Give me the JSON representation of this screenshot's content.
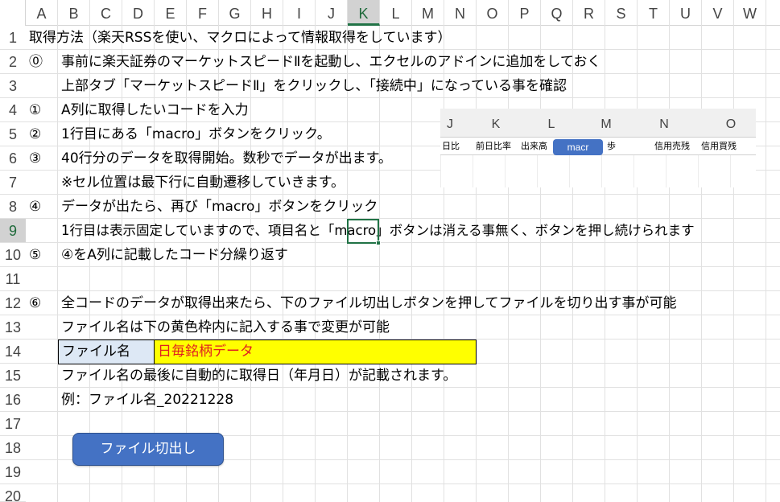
{
  "columns": [
    "A",
    "B",
    "C",
    "D",
    "E",
    "F",
    "G",
    "H",
    "I",
    "J",
    "K",
    "L",
    "M",
    "N",
    "O",
    "P",
    "Q",
    "R",
    "S",
    "T",
    "U",
    "V",
    "W"
  ],
  "active_column": "K",
  "rows": [
    "1",
    "2",
    "3",
    "4",
    "5",
    "6",
    "7",
    "8",
    "9",
    "10",
    "11",
    "12",
    "13",
    "14",
    "15",
    "16",
    "17",
    "18",
    "19",
    "20"
  ],
  "active_row": "9",
  "cells": {
    "r1": "取得方法（楽天RSSを使い、マクロによって情報取得をしています）",
    "r2_marker": "⓪",
    "r2": "事前に楽天証券のマーケットスピードⅡを起動し、エクセルのアドインに追加をしておく",
    "r3": "上部タブ「マーケットスピードⅡ」をクリックし、「接続中」になっている事を確認",
    "r4_marker": "①",
    "r4": "A列に取得したいコードを入力",
    "r5_marker": "②",
    "r5": "1行目にある「macro」ボタンをクリック。",
    "r6_marker": "③",
    "r6": "40行分のデータを取得開始。数秒でデータが出ます。",
    "r7": "※セル位置は最下行に自動遷移していきます。",
    "r8_marker": "④",
    "r8": "データが出たら、再び「macro」ボタンをクリック",
    "r9": "1行目は表示固定していますので、項目名と「macro」ボタンは消える事無く、ボタンを押し続けられます",
    "r10_marker": "⑤",
    "r10": "④をA列に記載したコード分繰り返す",
    "r12_marker": "⑥",
    "r12": "全コードのデータが取得出来たら、下のファイル切出しボタンを押してファイルを切り出す事が可能",
    "r13": "ファイル名は下の黄色枠内に記入する事で変更が可能",
    "r14_label": "ファイル名",
    "r14_value": "日毎銘柄データ",
    "r15": "ファイル名の最後に自動的に取得日（年月日）が記載されます。",
    "r16": "例：ファイル名_20221228"
  },
  "export_button_label": "ファイル切出し",
  "picture": {
    "headers": [
      "J",
      "K",
      "L",
      "M",
      "N",
      "O"
    ],
    "labels": [
      "日比",
      "前日比率",
      "出来高",
      "歩",
      "信用売残",
      "信用買残"
    ],
    "macro_button": "macr"
  },
  "colors": {
    "accent_green": "#217346",
    "button_blue": "#4472c4",
    "filename_fill": "#ffff00",
    "filename_label_fill": "#dde8f5",
    "filename_text": "#e02020"
  }
}
